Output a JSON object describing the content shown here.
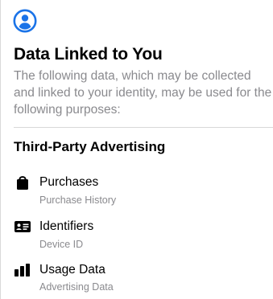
{
  "header": {
    "icon": "person-circle-icon",
    "title": "Data Linked to You",
    "description": "The following data, which may be collected and linked to your identity, may be used for the following purposes:"
  },
  "section": {
    "title": "Third-Party Advertising",
    "items": [
      {
        "icon": "shopping-bag-icon",
        "label": "Purchases",
        "sub": "Purchase History"
      },
      {
        "icon": "id-card-icon",
        "label": "Identifiers",
        "sub": "Device ID"
      },
      {
        "icon": "bar-chart-icon",
        "label": "Usage Data",
        "sub": "Advertising Data"
      }
    ]
  },
  "colors": {
    "accent": "#1a73e8",
    "secondary_text": "#8a8a8e"
  }
}
